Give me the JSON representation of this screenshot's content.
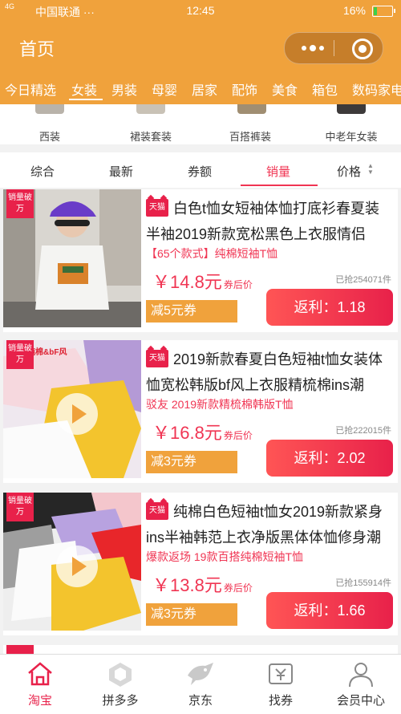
{
  "status_bar": {
    "signal": "4G",
    "carrier": "中国联通 ···",
    "time": "12:45",
    "battery": "16%"
  },
  "header": {
    "title": "首页"
  },
  "category_tabs": [
    {
      "label": "今日精选"
    },
    {
      "label": "女装",
      "active": true
    },
    {
      "label": "男装"
    },
    {
      "label": "母婴"
    },
    {
      "label": "居家"
    },
    {
      "label": "配饰"
    },
    {
      "label": "美食"
    },
    {
      "label": "箱包"
    },
    {
      "label": "数码家电"
    }
  ],
  "sub_categories": [
    "西装",
    "裙装套装",
    "百搭裤装",
    "中老年女装"
  ],
  "sort_options": [
    {
      "label": "综合"
    },
    {
      "label": "最新"
    },
    {
      "label": "券额"
    },
    {
      "label": "销量",
      "active": true
    },
    {
      "label": "价格"
    }
  ],
  "products": [
    {
      "badge": "销量破万",
      "shop_tag": "天猫",
      "title": "白色t恤女短袖体恤打底衫春夏装半袖2019新款宽松黑色上衣服情侣",
      "subtitle": "【65个款式】纯棉短袖T恤",
      "price": "￥14.8元",
      "price_unit": "券后价",
      "sold": "已抢254071件",
      "coupon": "减5元券",
      "rebate": "返利：1.18",
      "has_video": false
    },
    {
      "badge": "销量破万",
      "shop_tag": "天猫",
      "image_caption": "纯棉&bF风",
      "title": "2019新款春夏白色短袖t恤女装体恤宽松韩版bf风上衣服精梳棉ins潮",
      "subtitle": "驳友 2019新款精梳棉韩版T恤",
      "price": "￥16.8元",
      "price_unit": "券后价",
      "sold": "已抢222015件",
      "coupon": "减3元券",
      "rebate": "返利：2.02",
      "has_video": true
    },
    {
      "badge": "销量破万",
      "shop_tag": "天猫",
      "title": "纯棉白色短袖t恤女2019新款紧身ins半袖韩范上衣净版黑体体恤修身潮",
      "subtitle": "爆款返场 19款百搭纯棉短袖T恤",
      "price": "￥13.8元",
      "price_unit": "券后价",
      "sold": "已抢155914件",
      "coupon": "减3元券",
      "rebate": "返利：1.66",
      "has_video": true
    }
  ],
  "bottom_tabs": [
    {
      "label": "淘宝",
      "icon": "taobao-house-icon",
      "active": true
    },
    {
      "label": "拼多多",
      "icon": "pinduoduo-icon"
    },
    {
      "label": "京东",
      "icon": "jd-dog-icon"
    },
    {
      "label": "找券",
      "icon": "coupon-icon"
    },
    {
      "label": "会员中心",
      "icon": "user-icon"
    }
  ],
  "colors": {
    "brand_orange": "#f0a23c",
    "accent_red": "#e8214a",
    "price_red": "#f03553"
  }
}
